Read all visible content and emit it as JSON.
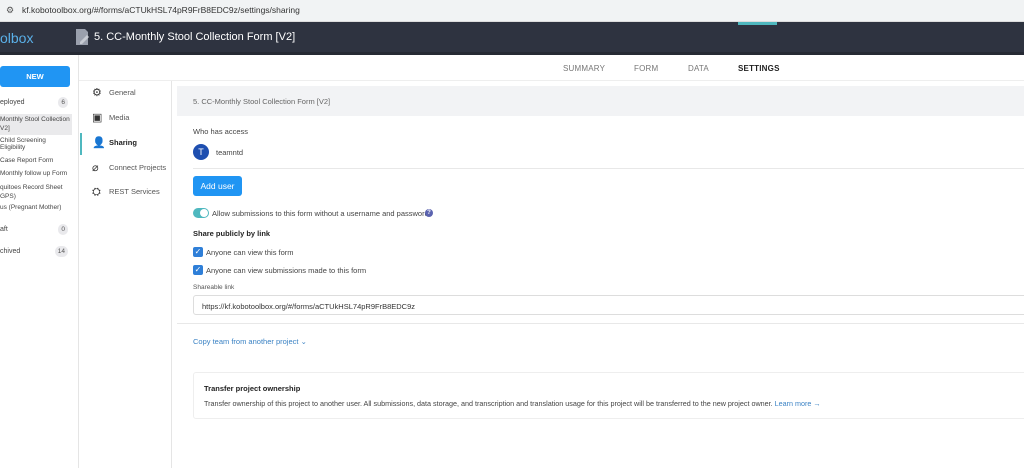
{
  "browser": {
    "url": "kf.kobotoolbox.org/#/forms/aCTUkHSL74pR9FrB8EDC9z/settings/sharing"
  },
  "header": {
    "logo": "olbox",
    "title": "5. CC-Monthly Stool Collection Form [V2]"
  },
  "sidebar": {
    "new_label": "NEW",
    "deployed": {
      "label": "eployed",
      "count": "6"
    },
    "items": [
      "Monthly Stool Collection",
      "V2]",
      "Child Screening Eligibility",
      "Case Report Form",
      "Monthly follow up Form",
      "quitoes Record Sheet",
      "GPS)",
      "us (Pregnant Mother)"
    ],
    "draft": {
      "label": "aft",
      "count": "0"
    },
    "archived": {
      "label": "chived",
      "count": "14"
    }
  },
  "tabs": [
    "SUMMARY",
    "FORM",
    "DATA",
    "SETTINGS"
  ],
  "settings_nav": [
    "General",
    "Media",
    "Sharing",
    "Connect Projects",
    "REST Services"
  ],
  "content": {
    "form_title": "5. CC-Monthly Stool Collection Form [V2]",
    "who_has_access": "Who has access",
    "user": {
      "initial": "T",
      "name": "teamntd"
    },
    "add_user": "Add user",
    "allow_anon": "Allow submissions to this form without a username and password",
    "allow_anon_on": true,
    "help": "?",
    "share_heading": "Share publicly by link",
    "check1": "Anyone can view this form",
    "check2": "Anyone can view submissions made to this form",
    "shareable_label": "Shareable link",
    "shareable_value": "https://kf.kobotoolbox.org/#/forms/aCTUkHSL74pR9FrB8EDC9z",
    "copy_team": "Copy team from another project",
    "transfer_title": "Transfer project ownership",
    "transfer_text": "Transfer ownership of this project to another user. All submissions, data storage, and transcription and translation usage for this project will be transferred to the new project owner.",
    "learn_more": "Learn more →"
  },
  "colors": {
    "accent": "#2095f3",
    "teal": "#4fb8bf",
    "header": "#2e3340"
  }
}
